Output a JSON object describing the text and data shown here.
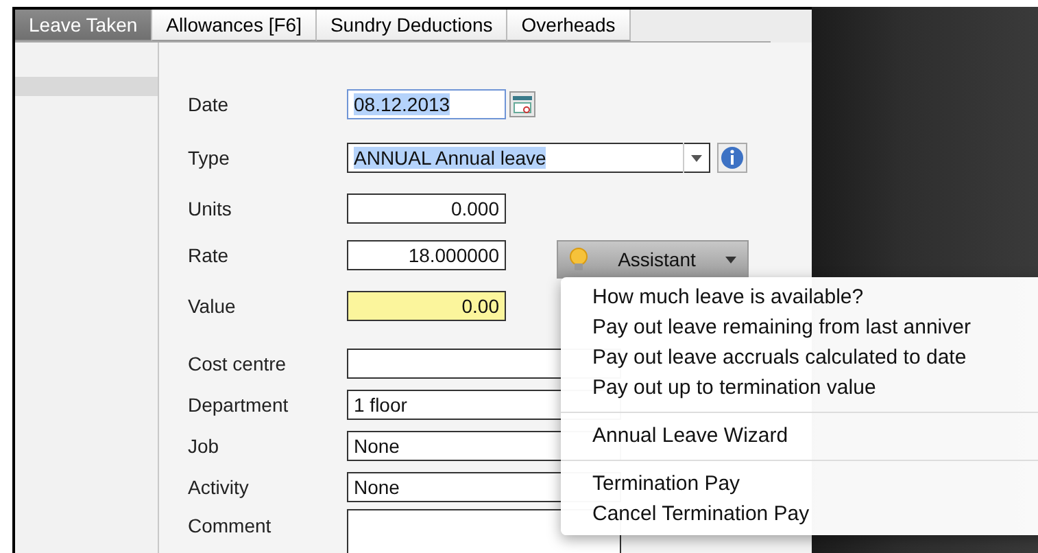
{
  "tabs": [
    {
      "label": "Leave Taken",
      "selected": true
    },
    {
      "label": "Allowances [F6]",
      "selected": false
    },
    {
      "label": "Sundry Deductions",
      "selected": false
    },
    {
      "label": "Overheads",
      "selected": false
    }
  ],
  "fields": [
    {
      "kind": "date",
      "label": "Date",
      "value": "08.12.2013",
      "highlighted": true
    },
    {
      "kind": "dropdown",
      "label": "Type",
      "value": "ANNUAL Annual leave",
      "highlighted": true
    },
    {
      "kind": "number",
      "label": "Units",
      "value": "0.000"
    },
    {
      "kind": "number",
      "label": "Rate",
      "value": "18.000000",
      "assistant": true
    },
    {
      "kind": "number",
      "label": "Value",
      "value": "0.00",
      "calculated": true
    },
    {
      "kind": "text",
      "label": "Cost centre"
    },
    {
      "kind": "text",
      "label": "Department",
      "value": "1 floor"
    },
    {
      "kind": "text",
      "label": "Job",
      "value": "None"
    },
    {
      "kind": "text",
      "label": "Activity",
      "value": "None"
    },
    {
      "kind": "textarea",
      "label": "Comment"
    }
  ],
  "assistant": {
    "label": "Assistant",
    "menu_open": true,
    "menu": [
      [
        "How much leave is available?",
        "Pay out leave remaining from last anniver",
        "Pay out leave accruals calculated to date",
        "Pay out up to termination value"
      ],
      [
        "Annual Leave Wizard"
      ],
      [
        "Termination Pay",
        "Cancel Termination Pay"
      ]
    ]
  }
}
